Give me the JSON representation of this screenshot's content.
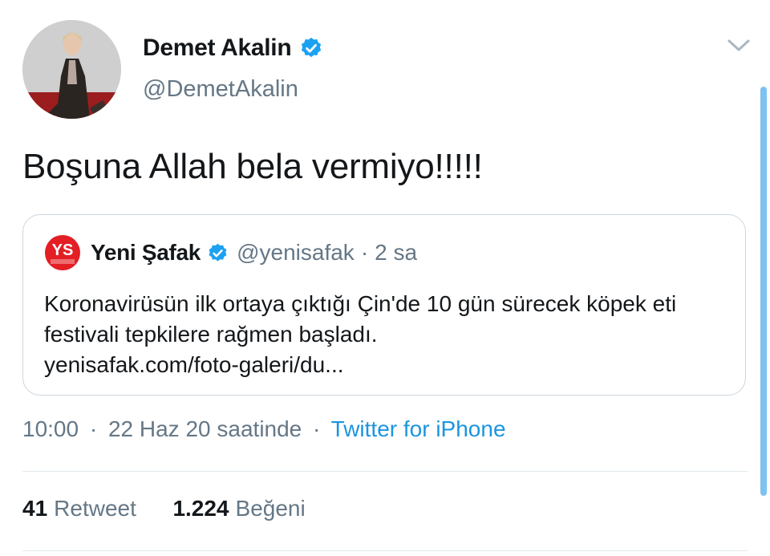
{
  "tweet": {
    "author": {
      "display_name": "Demet Akalin",
      "handle": "@DemetAkalin",
      "verified": true
    },
    "text": "Boşuna Allah bela vermiyo!!!!!",
    "quote": {
      "display_name": "Yeni Şafak",
      "handle": "@yenisafak",
      "separator": "·",
      "time": "2 sa",
      "verified": true,
      "body_lines": [
        "Koronavirüsün ilk ortaya çıktığı Çin'de 10 gün sürecek köpek eti",
        "festivali tepkilere rağmen başladı.",
        "yenisafak.com/foto-galeri/du..."
      ]
    },
    "meta": {
      "time": "10:00",
      "separator": "·",
      "date": "22 Haz 20 saatinde",
      "source": "Twitter for iPhone"
    },
    "stats": {
      "retweets_count": "41",
      "retweets_label": "Retweet",
      "likes_count": "1.224",
      "likes_label": "Beğeni"
    }
  },
  "icons": {
    "verified": "verified-badge-icon",
    "menu": "chevron-down-icon",
    "quote_logo": "yeni-safak-logo"
  },
  "colors": {
    "verified_blue": "#1da1f2",
    "link_blue": "#1b95e0",
    "secondary_text": "#657786",
    "border": "#ccd6dd",
    "logo_red": "#e31e24"
  }
}
